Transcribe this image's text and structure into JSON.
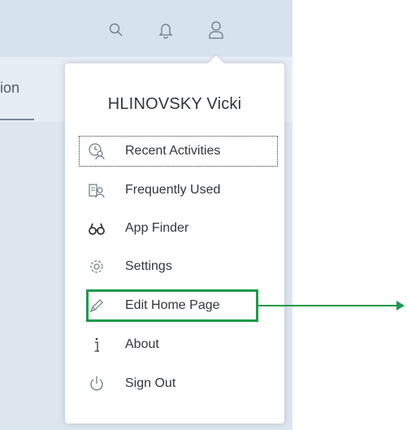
{
  "shell": {
    "icons": [
      {
        "name": "search-icon"
      },
      {
        "name": "bell-icon"
      },
      {
        "name": "user-icon"
      }
    ]
  },
  "tab": {
    "partial_label": "ion"
  },
  "user_menu": {
    "user_name": "HLINOVSKY Vicki",
    "items": [
      {
        "label": "Recent Activities",
        "icon": "recent-activities-icon"
      },
      {
        "label": "Frequently Used",
        "icon": "frequently-used-icon"
      },
      {
        "label": "App Finder",
        "icon": "binoculars-icon"
      },
      {
        "label": "Settings",
        "icon": "gear-icon"
      },
      {
        "label": "Edit Home Page",
        "icon": "pencil-icon"
      },
      {
        "label": "About",
        "icon": "info-icon"
      },
      {
        "label": "Sign Out",
        "icon": "power-icon"
      }
    ]
  },
  "colors": {
    "highlight": "#1c9a4a",
    "shell_background": "#d6e2ee",
    "text": "#32363a"
  }
}
